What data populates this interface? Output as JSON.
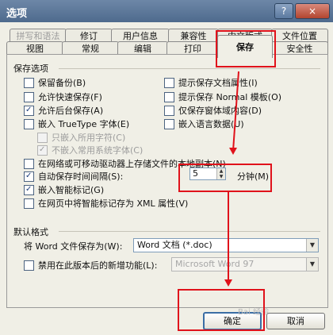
{
  "window": {
    "title": "选项",
    "help_icon": "?",
    "close_icon": "×"
  },
  "tabs": {
    "row1": [
      {
        "label": "拼写和语法",
        "state": "disabled"
      },
      {
        "label": "修订"
      },
      {
        "label": "用户信息"
      },
      {
        "label": "兼容性"
      },
      {
        "label": "中文版式"
      },
      {
        "label": "文件位置"
      }
    ],
    "row2": [
      {
        "label": "视图"
      },
      {
        "label": "常规"
      },
      {
        "label": "编辑"
      },
      {
        "label": "打印"
      },
      {
        "label": "保存",
        "state": "active"
      },
      {
        "label": "安全性"
      }
    ]
  },
  "save_options": {
    "group_title": "保存选项",
    "checkboxes": [
      {
        "label": "保留备份(B)",
        "checked": false,
        "enabled": true
      },
      {
        "label": "允许快速保存(F)",
        "checked": false,
        "enabled": true
      },
      {
        "label": "允许后台保存(A)",
        "checked": true,
        "enabled": true
      },
      {
        "label": "嵌入 TrueType 字体(E)",
        "checked": false,
        "enabled": true
      },
      {
        "label": "只嵌入所用字符(C)",
        "checked": false,
        "enabled": false
      },
      {
        "label": "不嵌入常用系统字体(C)",
        "checked": true,
        "enabled": false
      },
      {
        "label": "提示保存文档属性(I)",
        "checked": false,
        "enabled": true
      },
      {
        "label": "提示保存 Normal 模板(O)",
        "checked": false,
        "enabled": true
      },
      {
        "label": "仅保存窗体域内容(D)",
        "checked": false,
        "enabled": true
      },
      {
        "label": "嵌入语言数据(U)",
        "checked": false,
        "enabled": true
      },
      {
        "label": "在网络或可移动驱动器上存储文件的本地副本(N)",
        "checked": false,
        "enabled": true
      },
      {
        "label": "自动保存时间间隔(S):",
        "checked": true,
        "enabled": true
      },
      {
        "label": "嵌入智能标记(G)",
        "checked": true,
        "enabled": true
      },
      {
        "label": "在网页中将智能标记存为 XML 属性(V)",
        "checked": false,
        "enabled": true
      }
    ],
    "autosave_value": "5",
    "autosave_unit": "分钟(M)"
  },
  "default_format": {
    "group_title": "默认格式",
    "save_as_label": "将 Word 文件保存为(W):",
    "save_as_value": "Word 文档 (*.doc)",
    "disable_label": "禁用在此版本后的新增功能(L):",
    "disable_checked": false,
    "disable_value": "Microsoft Word 97"
  },
  "buttons": {
    "ok": "确定",
    "cancel": "取消"
  },
  "watermark": "Bai 经验",
  "colors": {
    "annotation": "#e0121b",
    "title_bar": "#5a7698",
    "panel": "#f0efe6"
  }
}
